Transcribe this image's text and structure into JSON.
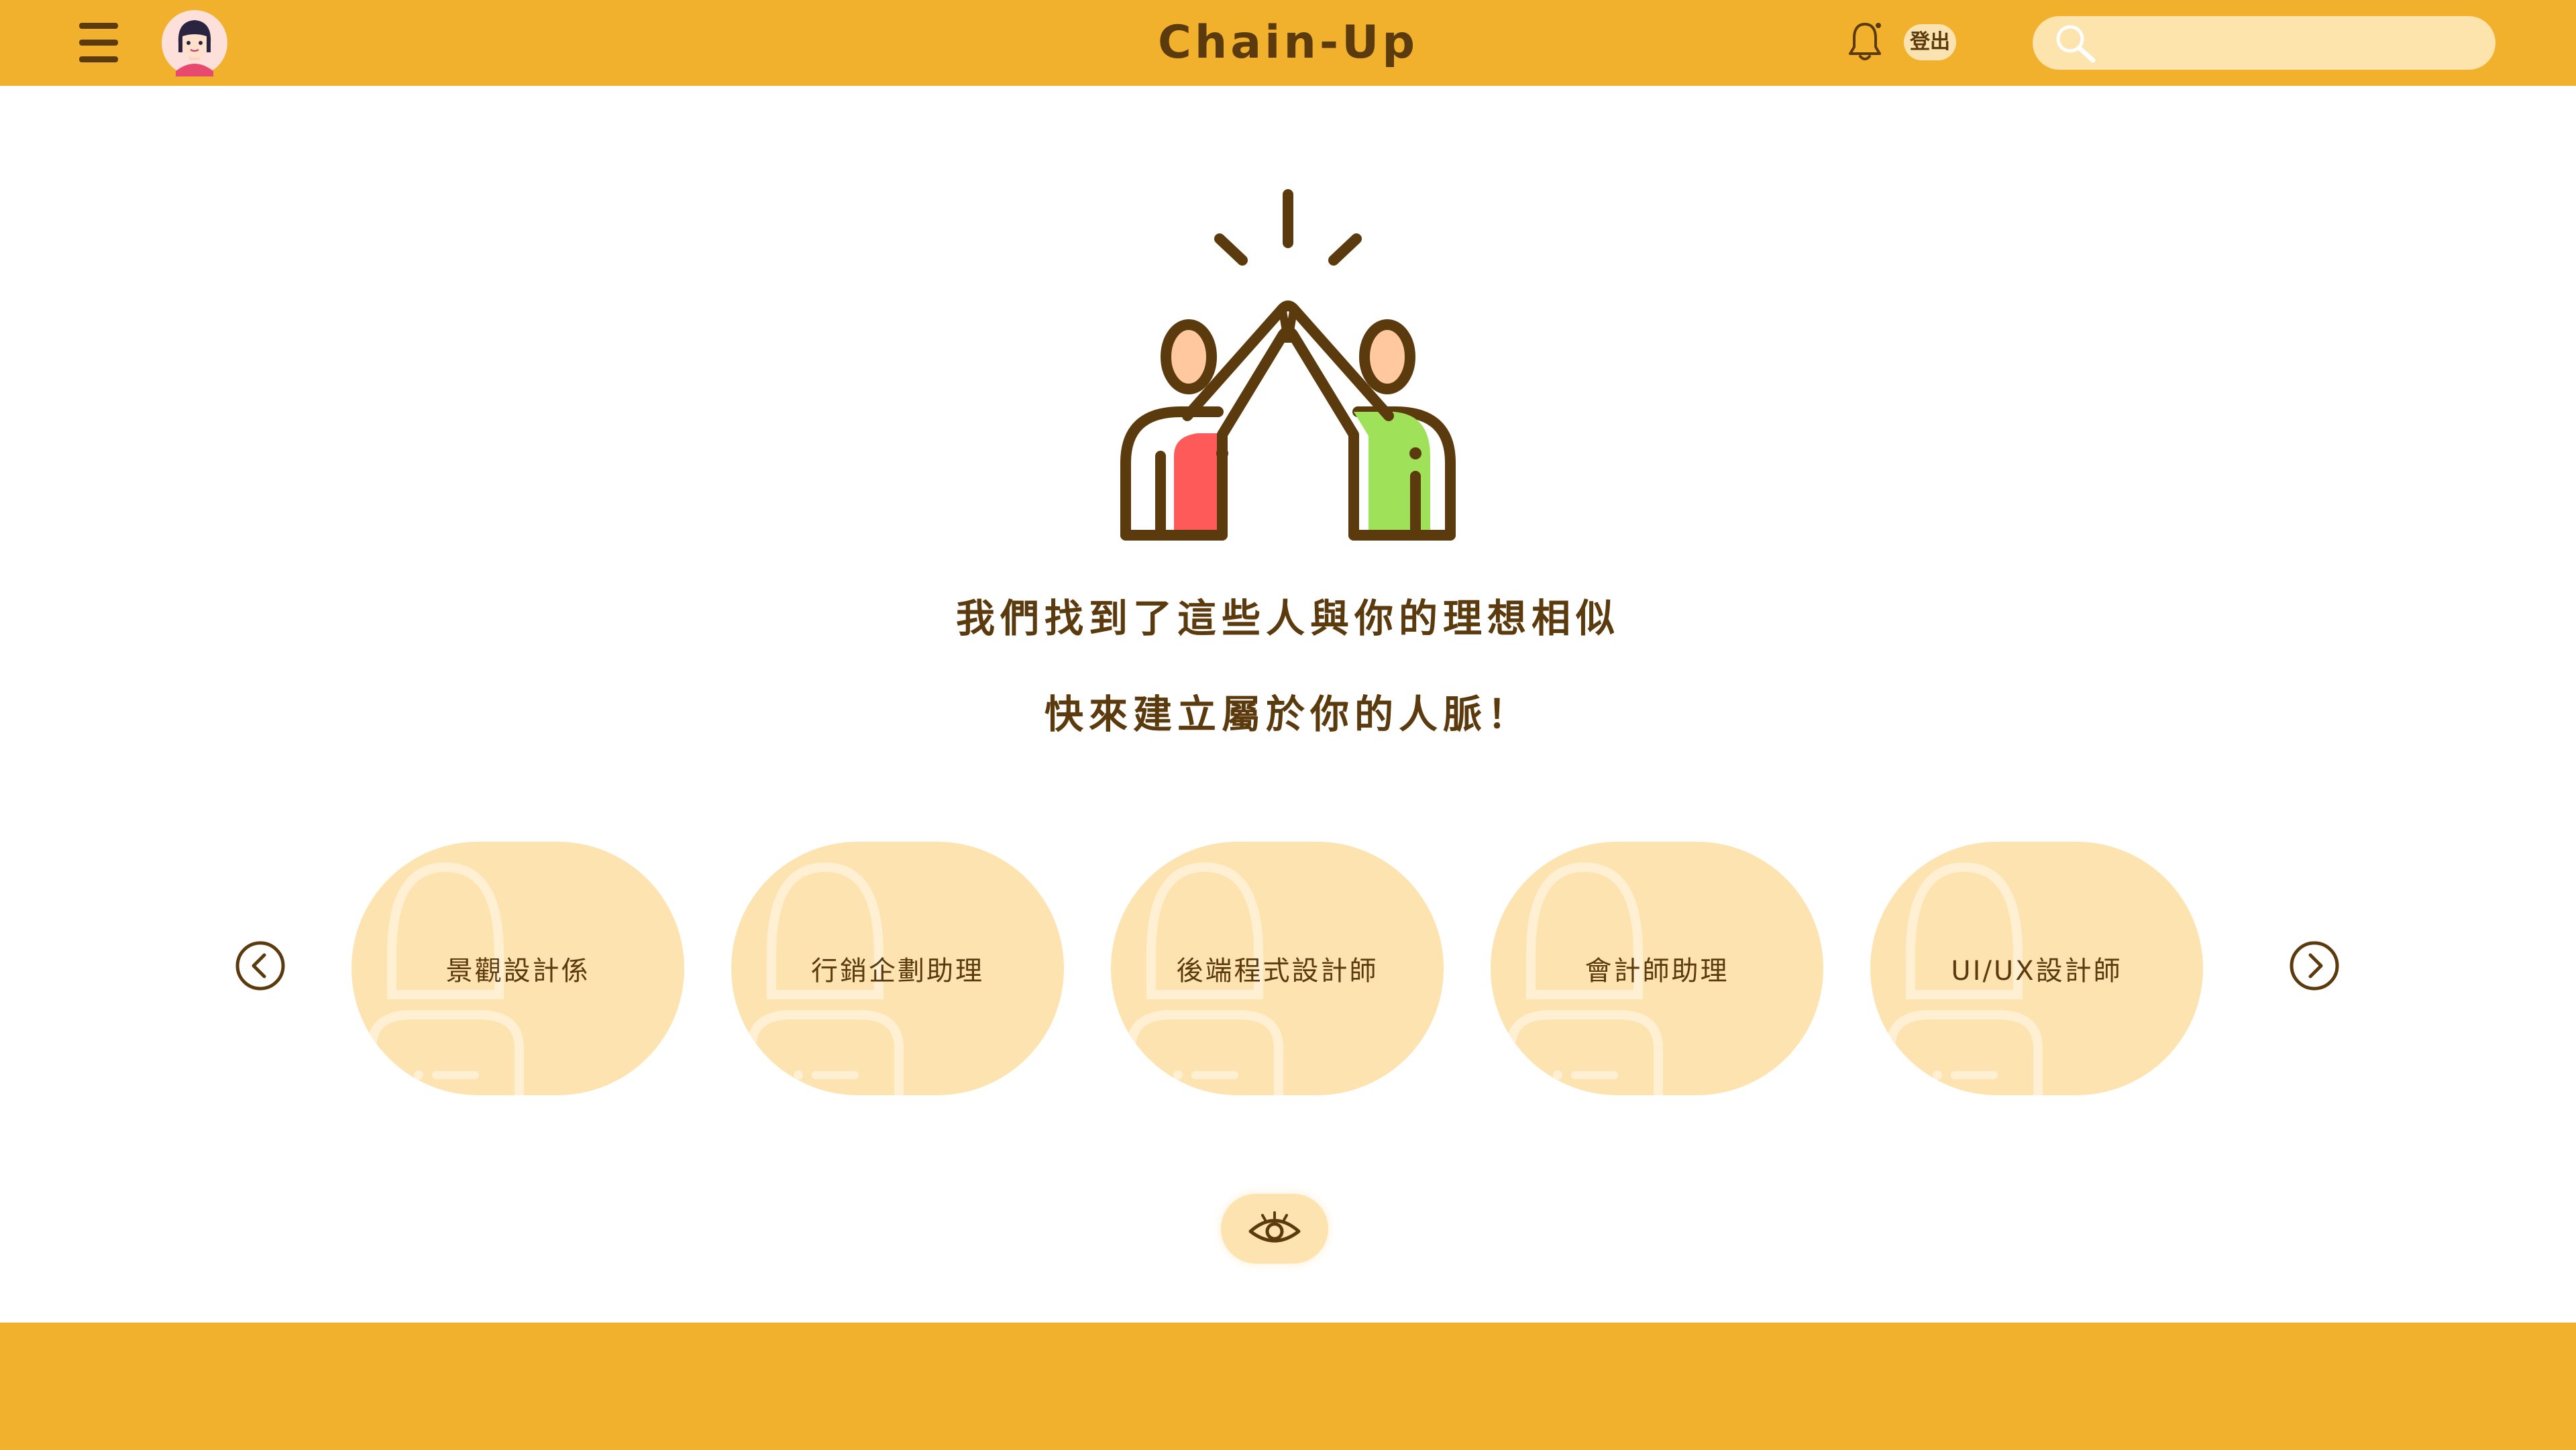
{
  "header": {
    "title": "Chain-Up",
    "logout_label": "登出",
    "search": {
      "value": "",
      "placeholder": ""
    },
    "icons": {
      "menu": "hamburger-menu-icon",
      "avatar": "user-avatar",
      "bell": "bell-icon",
      "search": "search-icon"
    }
  },
  "hero": {
    "illustration": "high-five-icon",
    "line1": "我們找到了這些人與你的理想相似",
    "line2": "快來建立屬於你的人脈！"
  },
  "carousel": {
    "prev_icon": "chevron-left-icon",
    "next_icon": "chevron-right-icon",
    "cards": [
      {
        "label": "景觀設計係"
      },
      {
        "label": "行銷企劃助理"
      },
      {
        "label": "後端程式設計師"
      },
      {
        "label": "會計師助理"
      },
      {
        "label": "UI/UX設計師"
      }
    ]
  },
  "view_button": {
    "icon": "eye-icon"
  },
  "colors": {
    "brand": "#f1b12d",
    "card": "#fde3b0",
    "text": "#5b3a0e",
    "red": "#ff5a5a",
    "green": "#9fe25a",
    "skin": "#ffc89e"
  }
}
